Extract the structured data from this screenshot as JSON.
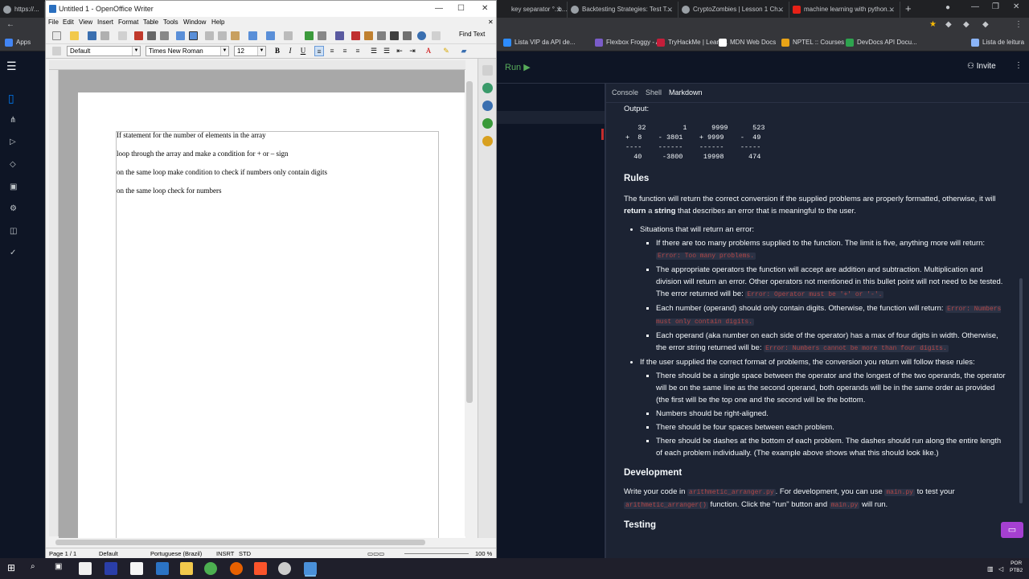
{
  "chrome": {
    "tabs": [
      {
        "label": "https://..."
      },
      {
        "label": "key separator °. b..."
      },
      {
        "label": "Backtesting Strategies: Test T..."
      },
      {
        "label": "CryptoZombies | Lesson 1 Ch..."
      },
      {
        "label": "machine learning with python..."
      }
    ],
    "bookmarks": [
      {
        "label": "Lista VIP da API de..."
      },
      {
        "label": "Flexbox Froggy - A..."
      },
      {
        "label": "TryHackMe | Learn..."
      },
      {
        "label": "MDN Web Docs"
      },
      {
        "label": "NPTEL :: Courses"
      },
      {
        "label": "DevDocs API Docu..."
      },
      {
        "label": "Lista de leitura"
      }
    ],
    "apps_label": "Apps"
  },
  "replit": {
    "run_label": "Run ▶",
    "invite_label": "Invite",
    "panel_tabs": [
      "Console",
      "Shell",
      "Markdown"
    ],
    "output_label": "Output:",
    "output_block": "   32         1      9999      523\n+  8    - 3801    + 9999    -  49\n----    ------    ------    -----\n  40     -3800     19998      474",
    "rules_heading": "Rules",
    "rules_text_1": "The function will return the correct conversion if the supplied problems are properly formatted, otherwise, it will ",
    "rules_bold_1": "return",
    "rules_text_2": " a ",
    "rules_bold_2": "string",
    "rules_text_3": " that describes an error that is meaningful to the user.",
    "situations_label": "Situations that will return an error:",
    "error_items": [
      {
        "text": "If there are too many problems supplied to the function. The limit is five, anything more will return: ",
        "code": "Error: Too many problems."
      },
      {
        "text": "The appropriate operators the function will accept are addition and subtraction. Multiplication and division will return an error. Other operators not mentioned in this bullet point will not need to be tested. The error returned will be: ",
        "code": "Error: Operator must be '+' or '-'."
      },
      {
        "text": "Each number (operand) should only contain digits. Otherwise, the function will return: ",
        "code": "Error: Numbers must only contain digits."
      },
      {
        "text": "Each operand (aka number on each side of the operator) has a max of four digits in width. Otherwise, the error string returned will be: ",
        "code": "Error: Numbers cannot be more than four digits."
      }
    ],
    "format_label": "If the user supplied the correct format of problems, the conversion you return will follow these rules:",
    "format_items": [
      "There should be a single space between the operator and the longest of the two operands, the operator will be on the same line as the second operand, both operands will be in the same order as provided (the first will be the top one and the second will be the bottom.",
      "Numbers should be right-aligned.",
      "There should be four spaces between each problem.",
      "There should be dashes at the bottom of each problem. The dashes should run along the entire length of each problem individually. (The example above shows what this should look like.)"
    ],
    "development_heading": "Development",
    "dev_text_1": "Write your code in ",
    "dev_code_1": "arithmetic_arranger.py",
    "dev_text_2": ". For development, you can use ",
    "dev_code_2": "main.py",
    "dev_text_3": " to test your ",
    "dev_code_3": "arithmetic_arranger()",
    "dev_text_4": " function. Click the \"run\" button and ",
    "dev_code_4": "main.py",
    "dev_text_5": " will run.",
    "testing_heading": "Testing"
  },
  "writer": {
    "window_title": "Untitled 1 - OpenOffice Writer",
    "menu": [
      "File",
      "Edit",
      "View",
      "Insert",
      "Format",
      "Table",
      "Tools",
      "Window",
      "Help"
    ],
    "find_text_label": "Find Text",
    "paragraph_style": "Default",
    "font_name": "Times New Roman",
    "font_size": "12",
    "doc_lines": [
      "If statement for the number of elements in the array",
      "loop through the array and make a condition for + or – sign",
      "on the same loop make condition to check if numbers only contain digits",
      "on the same loop check for numbers"
    ],
    "status": {
      "page": "Page 1 / 1",
      "style": "Default",
      "language": "Portuguese (Brazil)",
      "insert_mode": "INSRT",
      "selection_mode": "STD",
      "zoom": "100 %"
    }
  },
  "taskbar": {
    "lang_line1": "POR",
    "lang_line2": "PTB2"
  }
}
